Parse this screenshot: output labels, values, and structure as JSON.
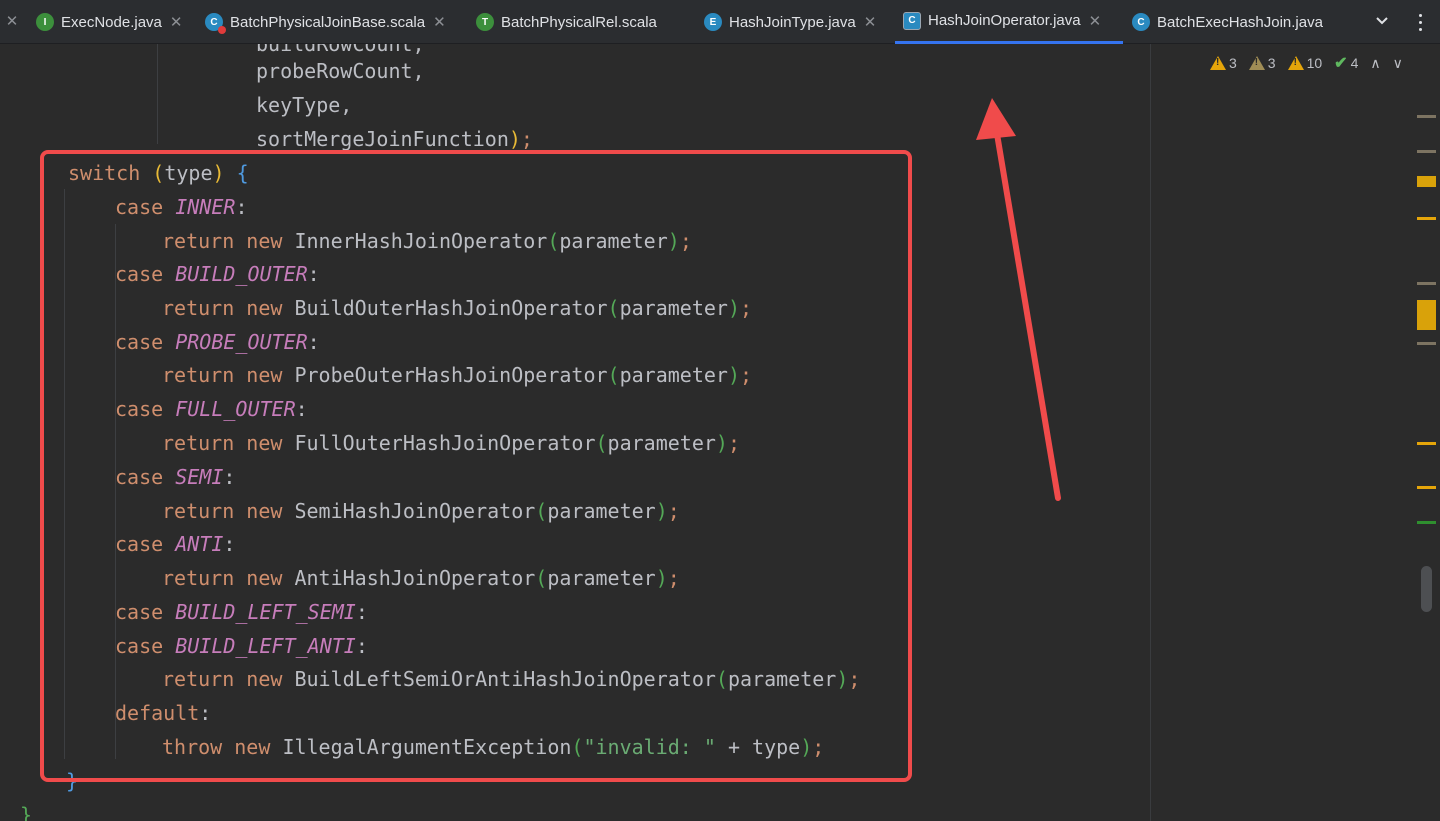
{
  "tabs": [
    {
      "label": "ExecNode.java",
      "icon": "interface-icon",
      "icon_letter": "I",
      "icon_color": "#3c8f3c",
      "active": false
    },
    {
      "label": "BatchPhysicalJoinBase.scala",
      "icon": "class-error-icon",
      "icon_letter": "C",
      "icon_color": "#2a8ac0",
      "active": false
    },
    {
      "label": "BatchPhysicalRel.scala",
      "icon": "trait-icon",
      "icon_letter": "T",
      "icon_color": "#3c8f3c",
      "active": false
    },
    {
      "label": "HashJoinType.java",
      "icon": "enum-icon",
      "icon_letter": "E",
      "icon_color": "#2a8ac0",
      "active": false
    },
    {
      "label": "HashJoinOperator.java",
      "icon": "abstract-class-icon",
      "icon_letter": "C",
      "icon_color": "#2a8ac0",
      "active": true
    },
    {
      "label": "BatchExecHashJoin.java",
      "icon": "class-icon",
      "icon_letter": "C",
      "icon_color": "#2a8ac0",
      "active": false
    }
  ],
  "inspections": {
    "warnings": "3",
    "weak_warnings": "3",
    "typos": "10",
    "ok": "4"
  },
  "code": {
    "l0": "buildRowCount,",
    "l1": "probeRowCount,",
    "l2": "keyType,",
    "l3_ident": "sortMergeJoinFunction",
    "switch_kw": "switch",
    "switch_var": "type",
    "case_kw": "case",
    "return_kw": "return",
    "new_kw": "new",
    "param": "parameter",
    "cases": [
      {
        "label": "INNER",
        "op": "InnerHashJoinOperator"
      },
      {
        "label": "BUILD_OUTER",
        "op": "BuildOuterHashJoinOperator"
      },
      {
        "label": "PROBE_OUTER",
        "op": "ProbeOuterHashJoinOperator"
      },
      {
        "label": "FULL_OUTER",
        "op": "FullOuterHashJoinOperator"
      },
      {
        "label": "SEMI",
        "op": "SemiHashJoinOperator"
      },
      {
        "label": "ANTI",
        "op": "AntiHashJoinOperator"
      }
    ],
    "case_left_semi": "BUILD_LEFT_SEMI",
    "case_left_anti": "BUILD_LEFT_ANTI",
    "op_left": "BuildLeftSemiOrAntiHashJoinOperator",
    "default_kw": "default",
    "throw_kw": "throw",
    "exception": "IllegalArgumentException",
    "message": "\"invalid: \"",
    "concat": " + ",
    "type_ref": "type"
  }
}
